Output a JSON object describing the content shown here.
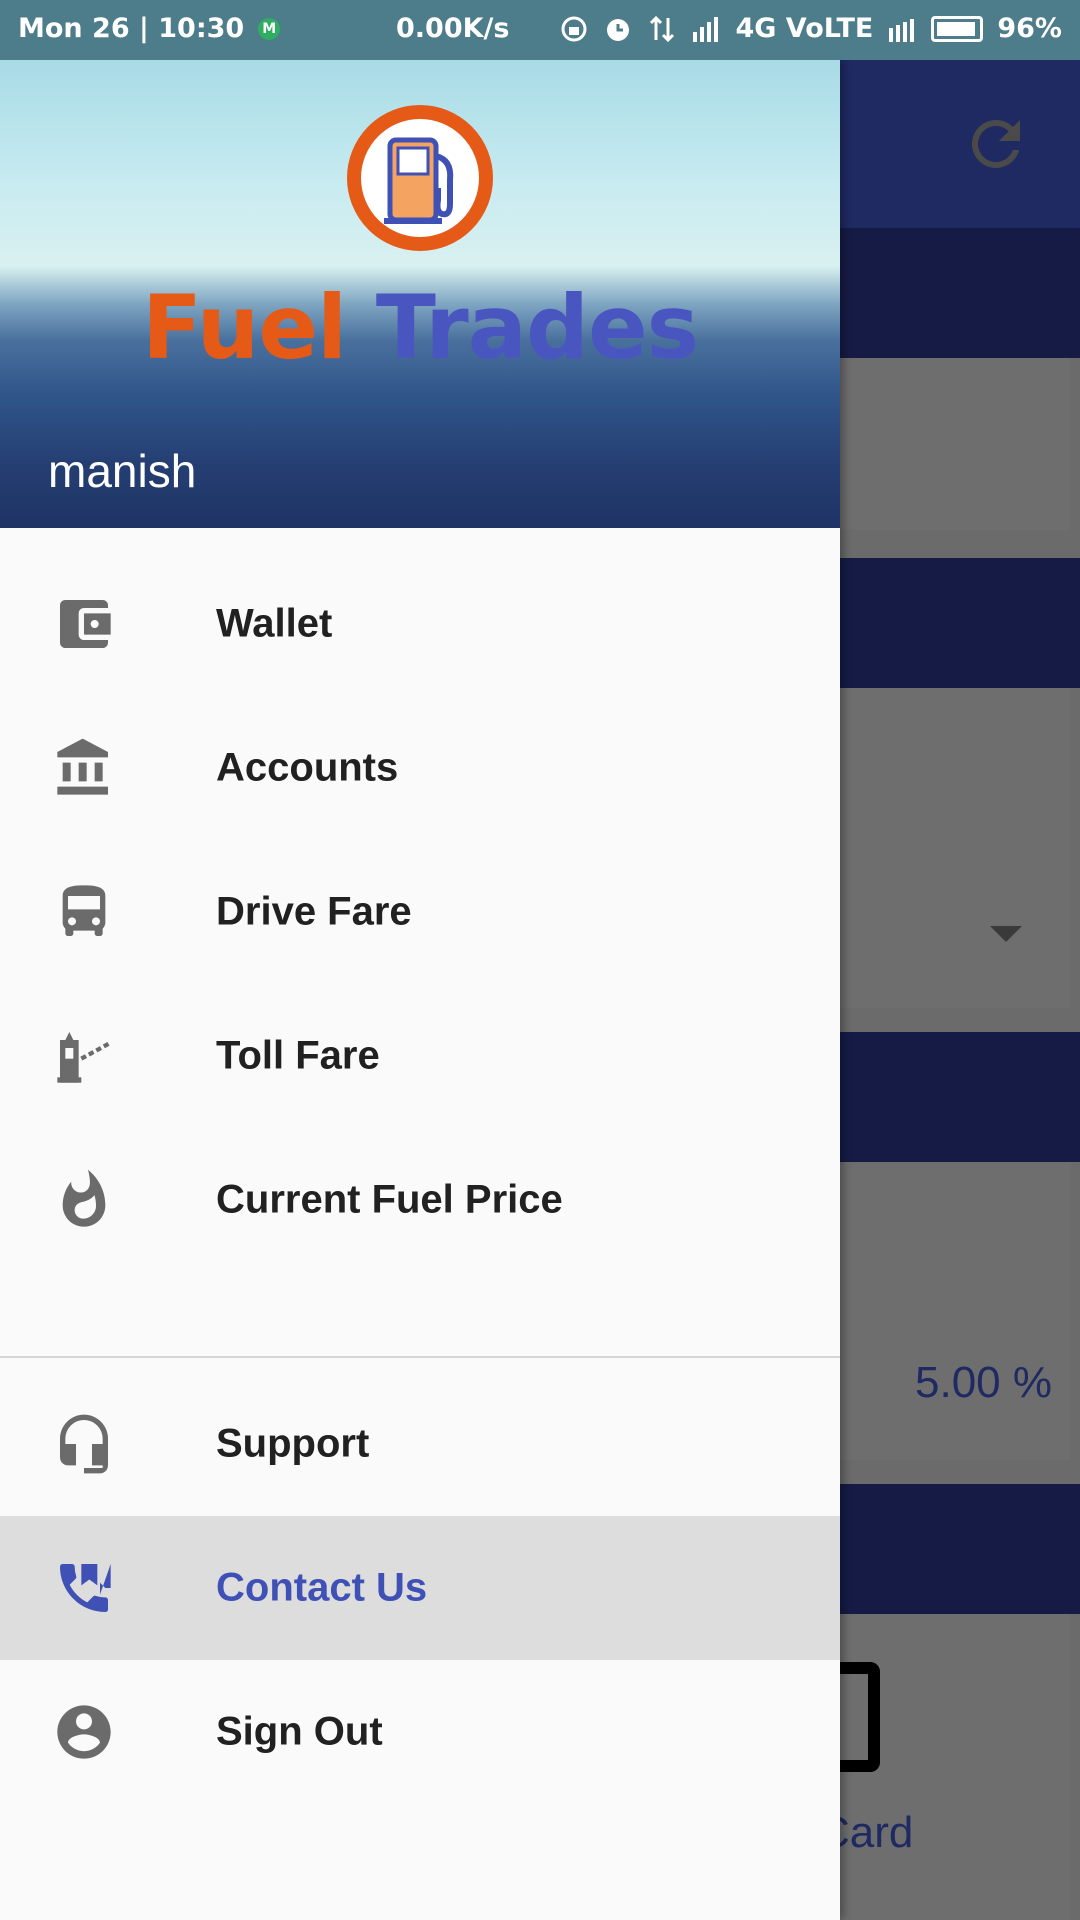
{
  "status_bar": {
    "datetime": "Mon 26 | 10:30",
    "notification_badge": "M",
    "net_speed": "0.00K/s",
    "network": "4G VoLTE",
    "battery": "96%"
  },
  "background": {
    "percent_value": "5.00 %",
    "card_label": "Card"
  },
  "drawer": {
    "brand_part1": "Fuel",
    "brand_part2": "Trades",
    "username": "manish",
    "items": [
      {
        "label": "Wallet",
        "icon": "wallet-icon"
      },
      {
        "label": "Accounts",
        "icon": "bank-icon"
      },
      {
        "label": "Drive Fare",
        "icon": "bus-icon"
      },
      {
        "label": "Toll Fare",
        "icon": "toll-booth-icon"
      },
      {
        "label": "Current Fuel Price",
        "icon": "flame-icon"
      },
      {
        "label": "Support",
        "icon": "headset-icon"
      },
      {
        "label": "Contact Us",
        "icon": "contact-phone-icon",
        "selected": true
      },
      {
        "label": "Sign Out",
        "icon": "account-circle-icon"
      }
    ]
  },
  "colors": {
    "brand_orange": "#e55a17",
    "brand_blue": "#4a56c0",
    "accent": "#3f51b5",
    "icon_grey": "#6b6b6b"
  }
}
